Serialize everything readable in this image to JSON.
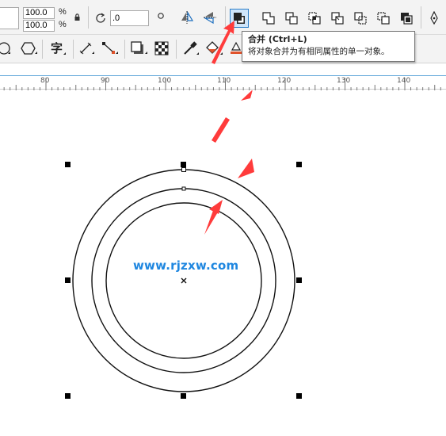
{
  "property_bar": {
    "scale_x": "100.0",
    "scale_y": "100.0",
    "scale_unit_x": "%",
    "scale_unit_y": "%",
    "rotation_angle": ".0"
  },
  "tooltip": {
    "title": "合并 (Ctrl+L)",
    "description": "将对象合并为有相同属性的单一对象。"
  },
  "ruler": {
    "labels": [
      "80",
      "90",
      "100",
      "110",
      "120",
      "130",
      "140"
    ]
  },
  "watermark": "www.rjzxw.com",
  "colors": {
    "accent_blue": "#1f87e0",
    "annotation_red": "#ff3b3b",
    "toolbar_bg": "#f3f3f3"
  }
}
